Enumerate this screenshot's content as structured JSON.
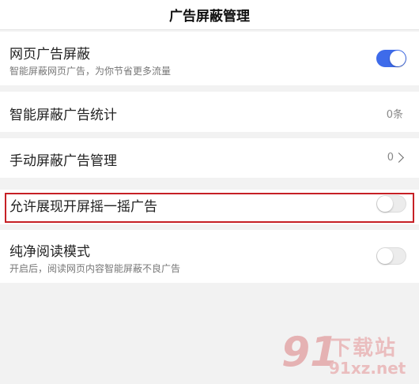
{
  "header": {
    "title": "广告屏蔽管理"
  },
  "rows": {
    "web_ad_block": {
      "label": "网页广告屏蔽",
      "description": "智能屏蔽网页广告，为你节省更多流量",
      "toggle_state": "on"
    },
    "ad_stats": {
      "label": "智能屏蔽广告统计",
      "value": "0条"
    },
    "manual_block": {
      "label": "手动屏蔽广告管理",
      "value": "0"
    },
    "shake_ad": {
      "label": "允许展现开屏摇一摇广告",
      "toggle_state": "off"
    },
    "pure_reading": {
      "label": "纯净阅读模式",
      "description": "开启后，阅读网页内容智能屏蔽不良广告",
      "toggle_state": "off"
    }
  },
  "colors": {
    "toggle_on": "#3e6bea",
    "highlight_border": "#c62025",
    "background": "#f2f2f2"
  },
  "watermark": {
    "number": "91",
    "title": "下载站",
    "domain": "91xz.net"
  }
}
